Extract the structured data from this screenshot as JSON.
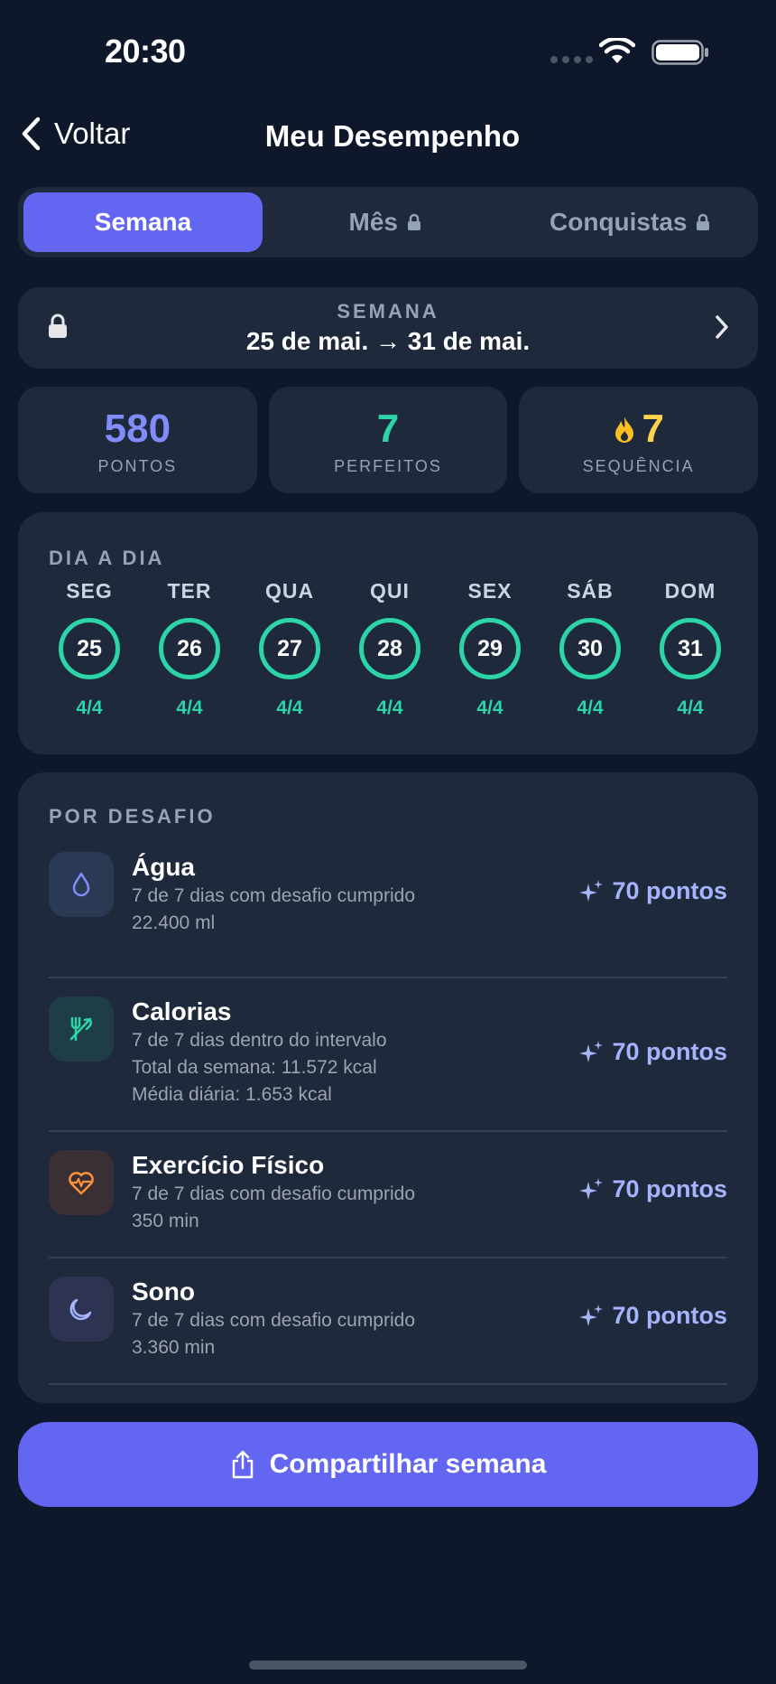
{
  "status_bar": {
    "time": "20:30"
  },
  "nav": {
    "back_label": "Voltar",
    "title": "Meu Desempenho"
  },
  "tabs": [
    {
      "label": "Semana",
      "active": true,
      "locked": false
    },
    {
      "label": "Mês",
      "active": false,
      "locked": true
    },
    {
      "label": "Conquistas",
      "active": false,
      "locked": true
    }
  ],
  "week": {
    "caption": "SEMANA",
    "range": "25 de mai. → 31 de mai."
  },
  "stats": {
    "points": {
      "value": "580",
      "label": "PONTOS",
      "color": "#818cf8"
    },
    "perfect": {
      "value": "7",
      "label": "PERFEITOS",
      "color": "#2dd4a7"
    },
    "streak": {
      "value": "7",
      "label": "SEQUÊNCIA",
      "color": "#fcd34d",
      "icon": "flame-icon"
    }
  },
  "daily": {
    "title": "DIA A DIA",
    "days": [
      {
        "name": "SEG",
        "date": "25",
        "score": "4/4"
      },
      {
        "name": "TER",
        "date": "26",
        "score": "4/4"
      },
      {
        "name": "QUA",
        "date": "27",
        "score": "4/4"
      },
      {
        "name": "QUI",
        "date": "28",
        "score": "4/4"
      },
      {
        "name": "SEX",
        "date": "29",
        "score": "4/4"
      },
      {
        "name": "SÁB",
        "date": "30",
        "score": "4/4"
      },
      {
        "name": "DOM",
        "date": "31",
        "score": "4/4"
      }
    ]
  },
  "challenges": {
    "title": "POR DESAFIO",
    "items": [
      {
        "name": "Água",
        "icon": "water-drop-icon",
        "lines": [
          "7 de 7 dias com desafio cumprido",
          "22.400 ml"
        ],
        "points": "70 pontos"
      },
      {
        "name": "Calorias",
        "icon": "fork-knife-icon",
        "lines": [
          "7 de 7 dias dentro do intervalo",
          "Total da semana: 11.572 kcal",
          "Média diária: 1.653 kcal"
        ],
        "points": "70 pontos"
      },
      {
        "name": "Exercício Físico",
        "icon": "heart-pulse-icon",
        "lines": [
          "7 de 7 dias com desafio cumprido",
          "350 min"
        ],
        "points": "70 pontos"
      },
      {
        "name": "Sono",
        "icon": "moon-icon",
        "lines": [
          "7 de 7 dias com desafio cumprido",
          "3.360 min"
        ],
        "points": "70 pontos"
      }
    ]
  },
  "share": {
    "label": "Compartilhar semana"
  }
}
